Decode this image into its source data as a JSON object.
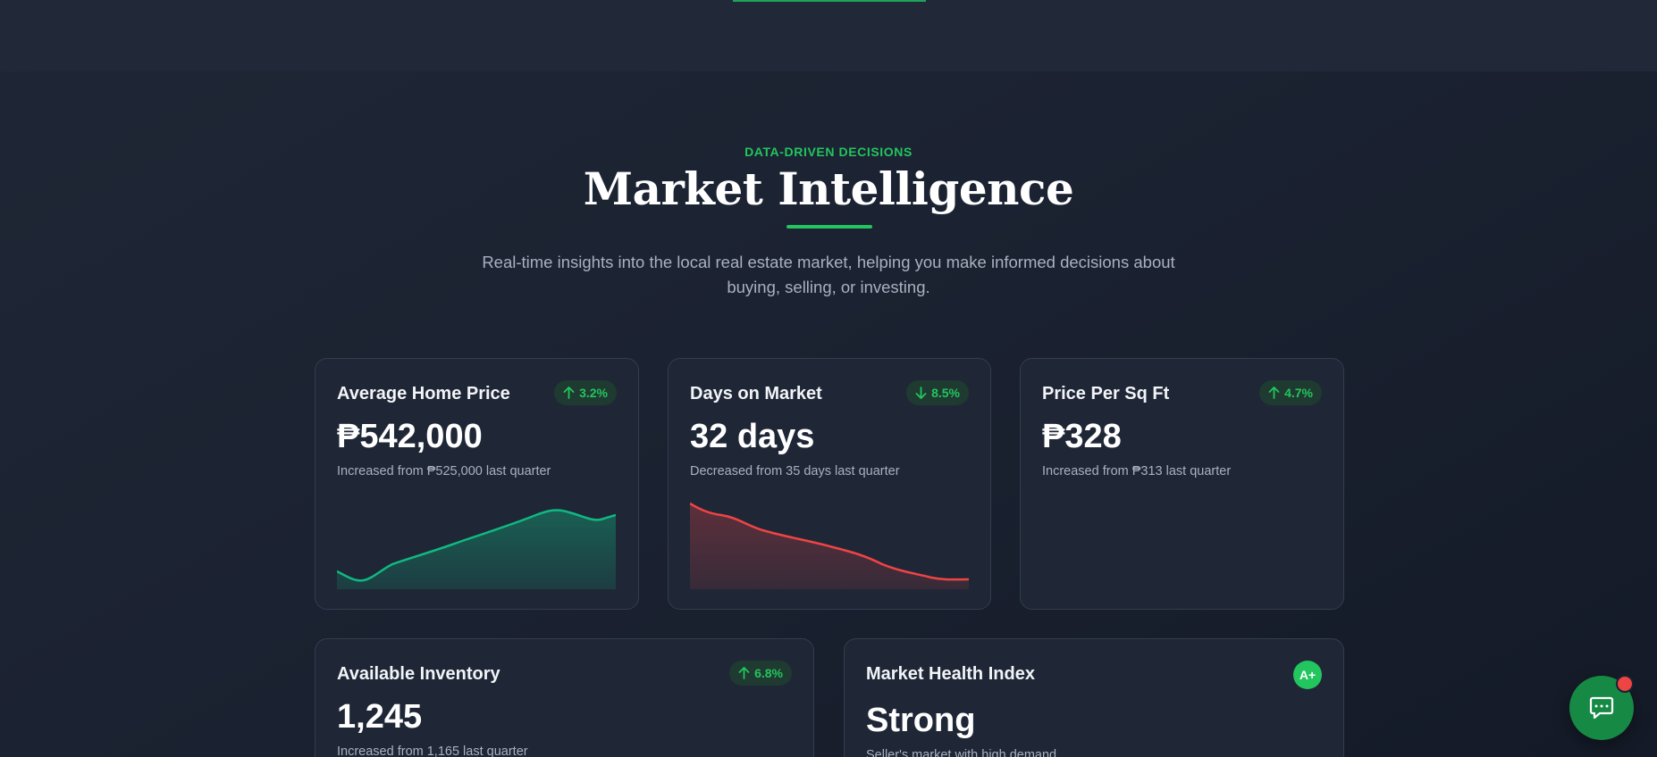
{
  "section": {
    "eyebrow": "DATA-DRIVEN DECISIONS",
    "title": "Market Intelligence",
    "subtitle": "Real-time insights into the local real estate market, helping you make informed decisions about buying, selling, or investing."
  },
  "cards": [
    {
      "title": "Average Home Price",
      "change": "3.2%",
      "direction": "up",
      "value": "₱542,000",
      "note": "Increased from ₱525,000 last quarter",
      "trend_color": "#10b981"
    },
    {
      "title": "Days on Market",
      "change": "8.5%",
      "direction": "down",
      "value": "32 days",
      "note": "Decreased from 35 days last quarter",
      "trend_color": "#ef4444"
    },
    {
      "title": "Price Per Sq Ft",
      "change": "4.7%",
      "direction": "up",
      "value": "₱328",
      "note": "Increased from ₱313 last quarter"
    },
    {
      "title": "Available Inventory",
      "change": "6.8%",
      "direction": "up",
      "value": "1,245",
      "note": "Increased from 1,165 last quarter"
    },
    {
      "title": "Market Health Index",
      "grade": "A+",
      "value": "Strong",
      "note": "Seller's market with high demand"
    }
  ],
  "chat": {
    "icon": "chat-bubble-icon",
    "notification": true,
    "accent": "#168a44",
    "dot_color": "#ef4444"
  },
  "colors": {
    "accent": "#22c55e",
    "positive": "#22c55e",
    "negative": "#ef4444",
    "card_bg": "#1f2737"
  }
}
